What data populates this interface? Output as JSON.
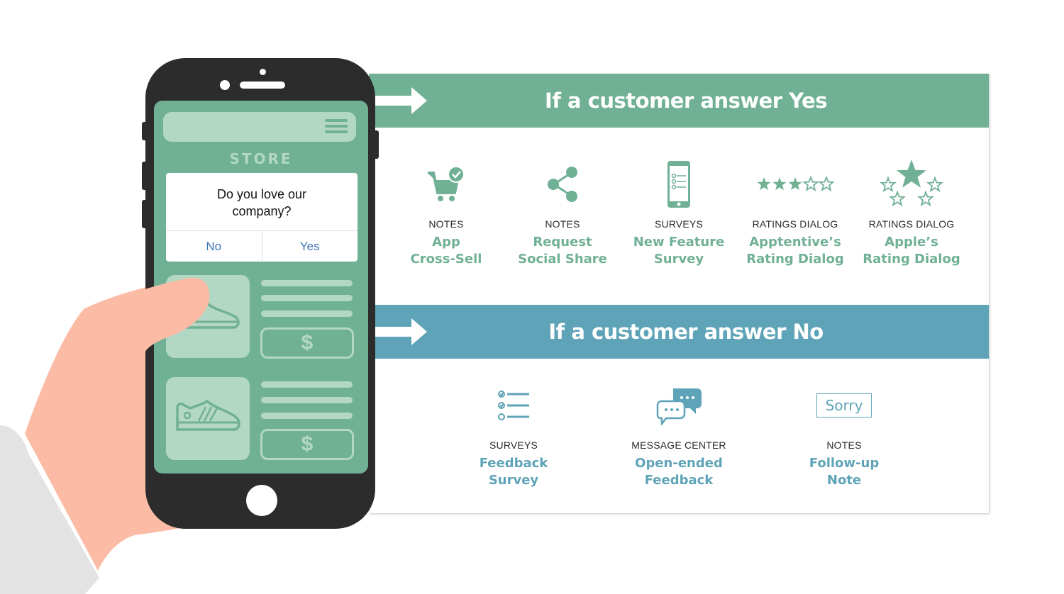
{
  "colors": {
    "yes_accent": "#70b095",
    "no_accent": "#5ea3b7",
    "phone_body": "#2c2c2c",
    "screen": "#70b095",
    "screen_light": "#b3d7c5",
    "skin": "#fbbba4",
    "sleeve": "#e3e3e3",
    "dialog_button_text": "#3d73b8"
  },
  "phone": {
    "store_label": "STORE",
    "dialog": {
      "question": "Do you love our\ncompany?",
      "no_label": "No",
      "yes_label": "Yes"
    },
    "products": [
      {
        "icon": "sneaker-icon",
        "price_symbol": "$"
      },
      {
        "icon": "sneaker-icon",
        "price_symbol": "$"
      }
    ]
  },
  "yes_section": {
    "title": "If a customer answer Yes",
    "items": [
      {
        "icon": "cart-check-icon",
        "category": "NOTES",
        "name": "App\nCross-Sell"
      },
      {
        "icon": "share-icon",
        "category": "NOTES",
        "name": "Request\nSocial Share"
      },
      {
        "icon": "phone-survey-icon",
        "category": "SURVEYS",
        "name": "New Feature\nSurvey"
      },
      {
        "icon": "star-rating-icon",
        "category": "RATINGS DIALOG",
        "name": "Apptentive’s\nRating Dialog",
        "stars_filled": 3,
        "stars_total": 5
      },
      {
        "icon": "star-cluster-icon",
        "category": "RATINGS DIALOG",
        "name": "Apple’s\nRating Dialog"
      }
    ]
  },
  "no_section": {
    "title": "If a customer answer No",
    "items": [
      {
        "icon": "checklist-icon",
        "category": "SURVEYS",
        "name": "Feedback\nSurvey"
      },
      {
        "icon": "chat-bubbles-icon",
        "category": "MESSAGE CENTER",
        "name": "Open-ended\nFeedback"
      },
      {
        "icon": "sorry-note-icon",
        "category": "NOTES",
        "name": "Follow-up\nNote",
        "note_text": "Sorry"
      }
    ]
  }
}
